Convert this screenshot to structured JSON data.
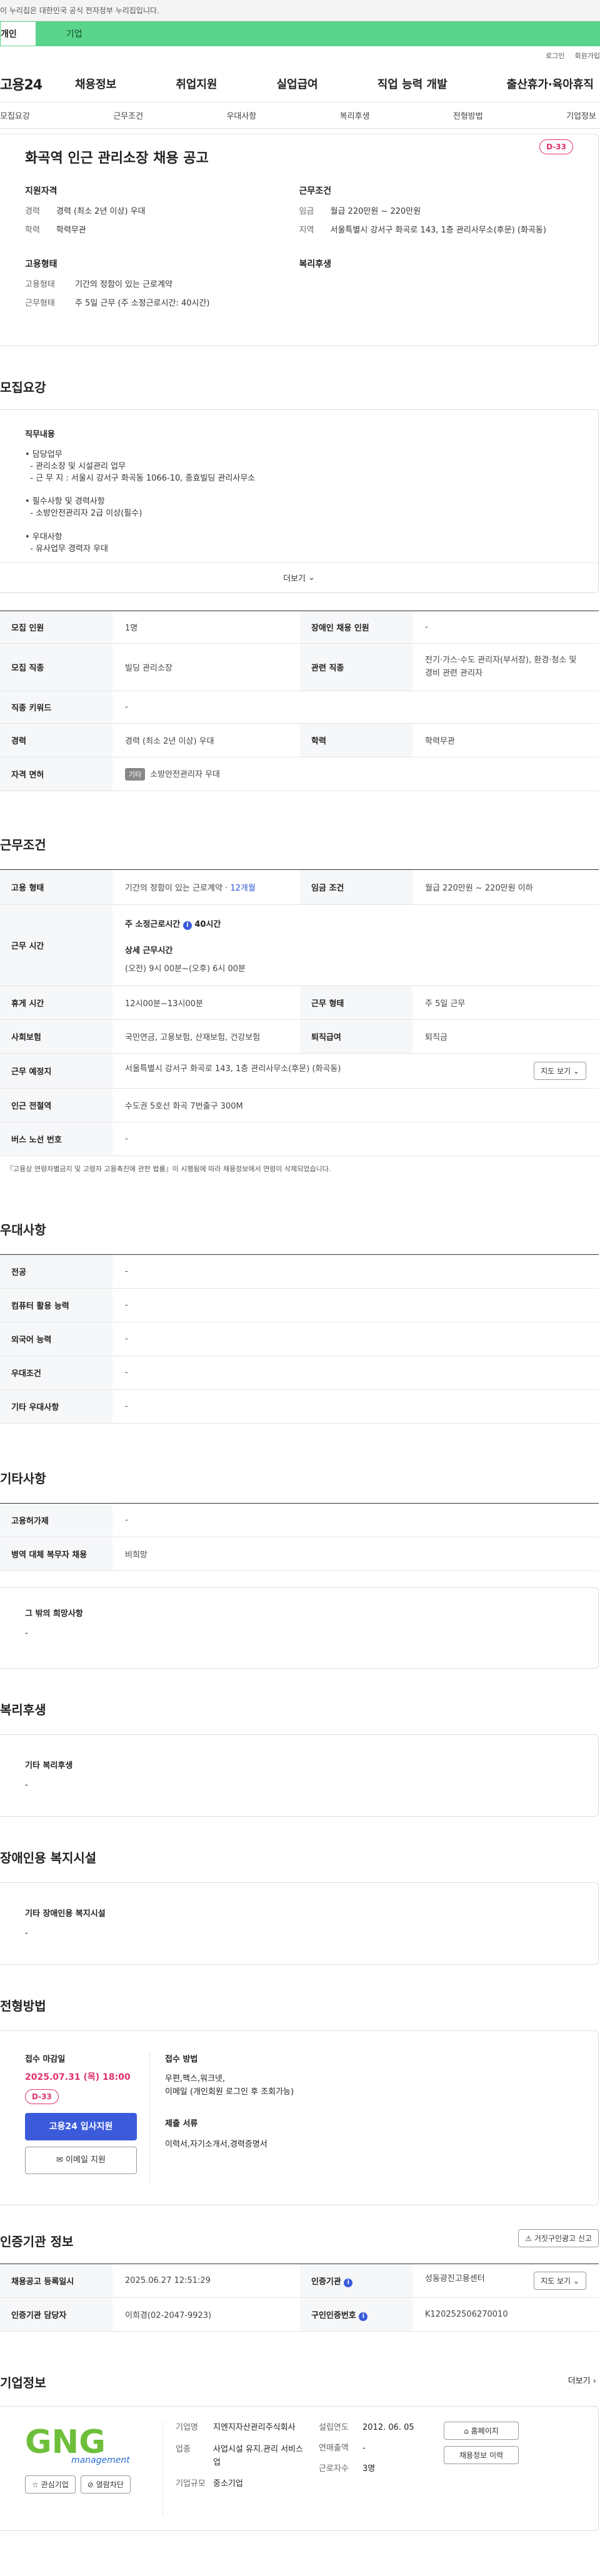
{
  "gov_banner": "이 누리집은 대한민국 공식 전자정부 누리집입니다.",
  "user_tabs": [
    "개인",
    "기업"
  ],
  "top_links": [
    "로그인",
    "회원가입"
  ],
  "site_logo": "고용24",
  "gnb": [
    "채용정보",
    "취업지원",
    "실업급여",
    "직업 능력 개발",
    "출산휴가·육아휴직"
  ],
  "subnav": [
    "모집요강",
    "근무조건",
    "우대사항",
    "복리후생",
    "전형방법",
    "기업정보"
  ],
  "job": {
    "title": "화곡역 인근 관리소장 채용 공고",
    "dday": "D-33",
    "qual_title": "지원자격",
    "qual": [
      {
        "k": "경력",
        "v": "경력 (최소 2년 이상) 우대"
      },
      {
        "k": "학력",
        "v": "학력무관"
      }
    ],
    "cond_title": "근무조건",
    "cond": [
      {
        "k": "임금",
        "v": "월급 220만원 ~ 220만원"
      },
      {
        "k": "지역",
        "v": "서울특별시 강서구 화곡로 143, 1층 관리사무소(후문) (화곡동)"
      }
    ],
    "emp_title": "고용형태",
    "emp": [
      {
        "k": "고용형태",
        "v": "기간의 정함이 있는 근로계약"
      },
      {
        "k": "근무형태",
        "v": "주 5일 근무 (주 소정근로시간: 40시간)"
      }
    ],
    "welfare_title": "복리후생"
  },
  "recruit": {
    "heading": "모집요강",
    "duties_label": "직무내용",
    "duties": [
      "• 담당업무",
      "  - 관리소장 및 시설관리 업무",
      "  - 근 무 지 : 서울시 강서구 화곡동 1066-10, 종효빌딩 관리사무소",
      "",
      "• 필수사항 및 경력사항",
      "  - 소방안전관리자 2급 이상(필수)",
      "",
      "• 우대사항",
      "  - 유사업무 경력자 우대"
    ],
    "more": "더보기",
    "rows": [
      [
        "모집 인원",
        "1명",
        "장애인 채용 인원",
        "-"
      ],
      [
        "모집 직종",
        "빌딩 관리소장",
        "관련 직종",
        "전기·가스·수도 관리자(부서장), 환경·청소 및 경비 관련 관리자"
      ],
      [
        "직종 키워드",
        "-",
        "",
        ""
      ],
      [
        "경력",
        "경력 (최소 2년 이상) 우대",
        "학력",
        "학력무관"
      ]
    ],
    "license_label": "자격 면허",
    "license_chip": "기타",
    "license_value": "소방안전관리자 우대"
  },
  "work": {
    "heading": "근무조건",
    "emp_type_label": "고용 형태",
    "emp_type": "기간의 정함이 있는 근로계약 · ",
    "emp_type_link": "12개월",
    "wage_label": "임금 조건",
    "wage": "월급 220만원 ~ 220만원 이하",
    "hours_label": "근무 시간",
    "weekly_hours": "주 소정근로시간",
    "weekly_hours_val": "40시간",
    "detail_label": "상세 근무시간",
    "detail_val": "(오전) 9시 00분~(오후) 6시 00분",
    "rest_label": "휴게 시간",
    "rest": "12시00분~13시00분",
    "form_label": "근무 형태",
    "form": "주 5일 근무",
    "ins_label": "사회보험",
    "ins": "국민연금, 고용보험, 산재보험, 건강보험",
    "sev_label": "퇴직급여",
    "sev": "퇴직금",
    "place_label": "근무 예정지",
    "place": "서울특별시 강서구 화곡로 143, 1층 관리사무소(후문) (화곡동)",
    "map_btn": "지도 보기",
    "subway_label": "인근 전철역",
    "subway": "수도권 5호선 화곡 7번출구 300M",
    "bus_label": "버스 노선 번호",
    "bus": "-",
    "note": "『고용상 연령차별금지 및 고령자 고용촉진에 관한 법률』이 시행됨에 따라 채용정보에서 연령이 삭제되었습니다."
  },
  "pref": {
    "heading": "우대사항",
    "rows": [
      [
        "전공",
        "-"
      ],
      [
        "컴퓨터 활용 능력",
        "-"
      ],
      [
        "외국어 능력",
        "-"
      ],
      [
        "우대조건",
        "-"
      ],
      [
        "기타 우대사항",
        "-"
      ]
    ]
  },
  "etc": {
    "heading": "기타사항",
    "rows": [
      [
        "고용허가제",
        "-"
      ],
      [
        "병역 대체 복무자 채용",
        "비희망"
      ]
    ],
    "other_label": "그 밖의 희망사항",
    "other_val": "-"
  },
  "welfare": {
    "heading": "복리후생",
    "label": "기타 복리후생",
    "val": "-"
  },
  "disab": {
    "heading": "장애인용 복지시설",
    "label": "기타 장애인용 복지시설",
    "val": "-"
  },
  "selection": {
    "heading": "전형방법",
    "deadline_label": "접수 마감일",
    "deadline": "2025.07.31 (목) 18:00",
    "dday": "D-33",
    "apply_btn": "고용24 입사지원",
    "email_btn": "이메일 지원",
    "method_label": "접수 방법",
    "method": "우편,팩스,워크넷,",
    "method2": "이메일 (개인회원 로그인 후 조회가능)",
    "docs_label": "제출 서류",
    "docs": "이력서,자기소개서,경력증명서"
  },
  "cert": {
    "heading": "인증기관 정보",
    "report_btn": "거짓구인광고 신고",
    "reg_label": "채용공고 등록일시",
    "reg": "2025.06.27 12:51:29",
    "org_label": "인증기관",
    "org": "성동광진고용센터",
    "map_btn": "지도 보기",
    "mgr_label": "인증기관 담당자",
    "mgr": "이희경(02-2047-9923)",
    "num_label": "구인인증번호",
    "num": "K120252506270010"
  },
  "company": {
    "heading": "기업정보",
    "more": "더보기",
    "logo_text": "GNG",
    "logo_sub": "management",
    "fav_btn": "관심기업",
    "block_btn": "열람차단",
    "industry_label": "업종",
    "industry": "사업시설 유지.관리 서비스업",
    "name_label": "기업명",
    "name": "지엔지자산관리주식회사",
    "scale_label": "기업규모",
    "scale": "중소기업",
    "founded_label": "설립연도",
    "founded": "2012. 06. 05",
    "sales_label": "연매출액",
    "sales": "-",
    "employees_label": "근로자수",
    "employees": "3명",
    "homepage_btn": "홈페이지",
    "jobs_btn": "채용정보 이력"
  },
  "colors": {
    "accent": "#3b5bdb",
    "green": "#5bd48c",
    "dday": "#e1306c",
    "link": "#2b57d4"
  }
}
